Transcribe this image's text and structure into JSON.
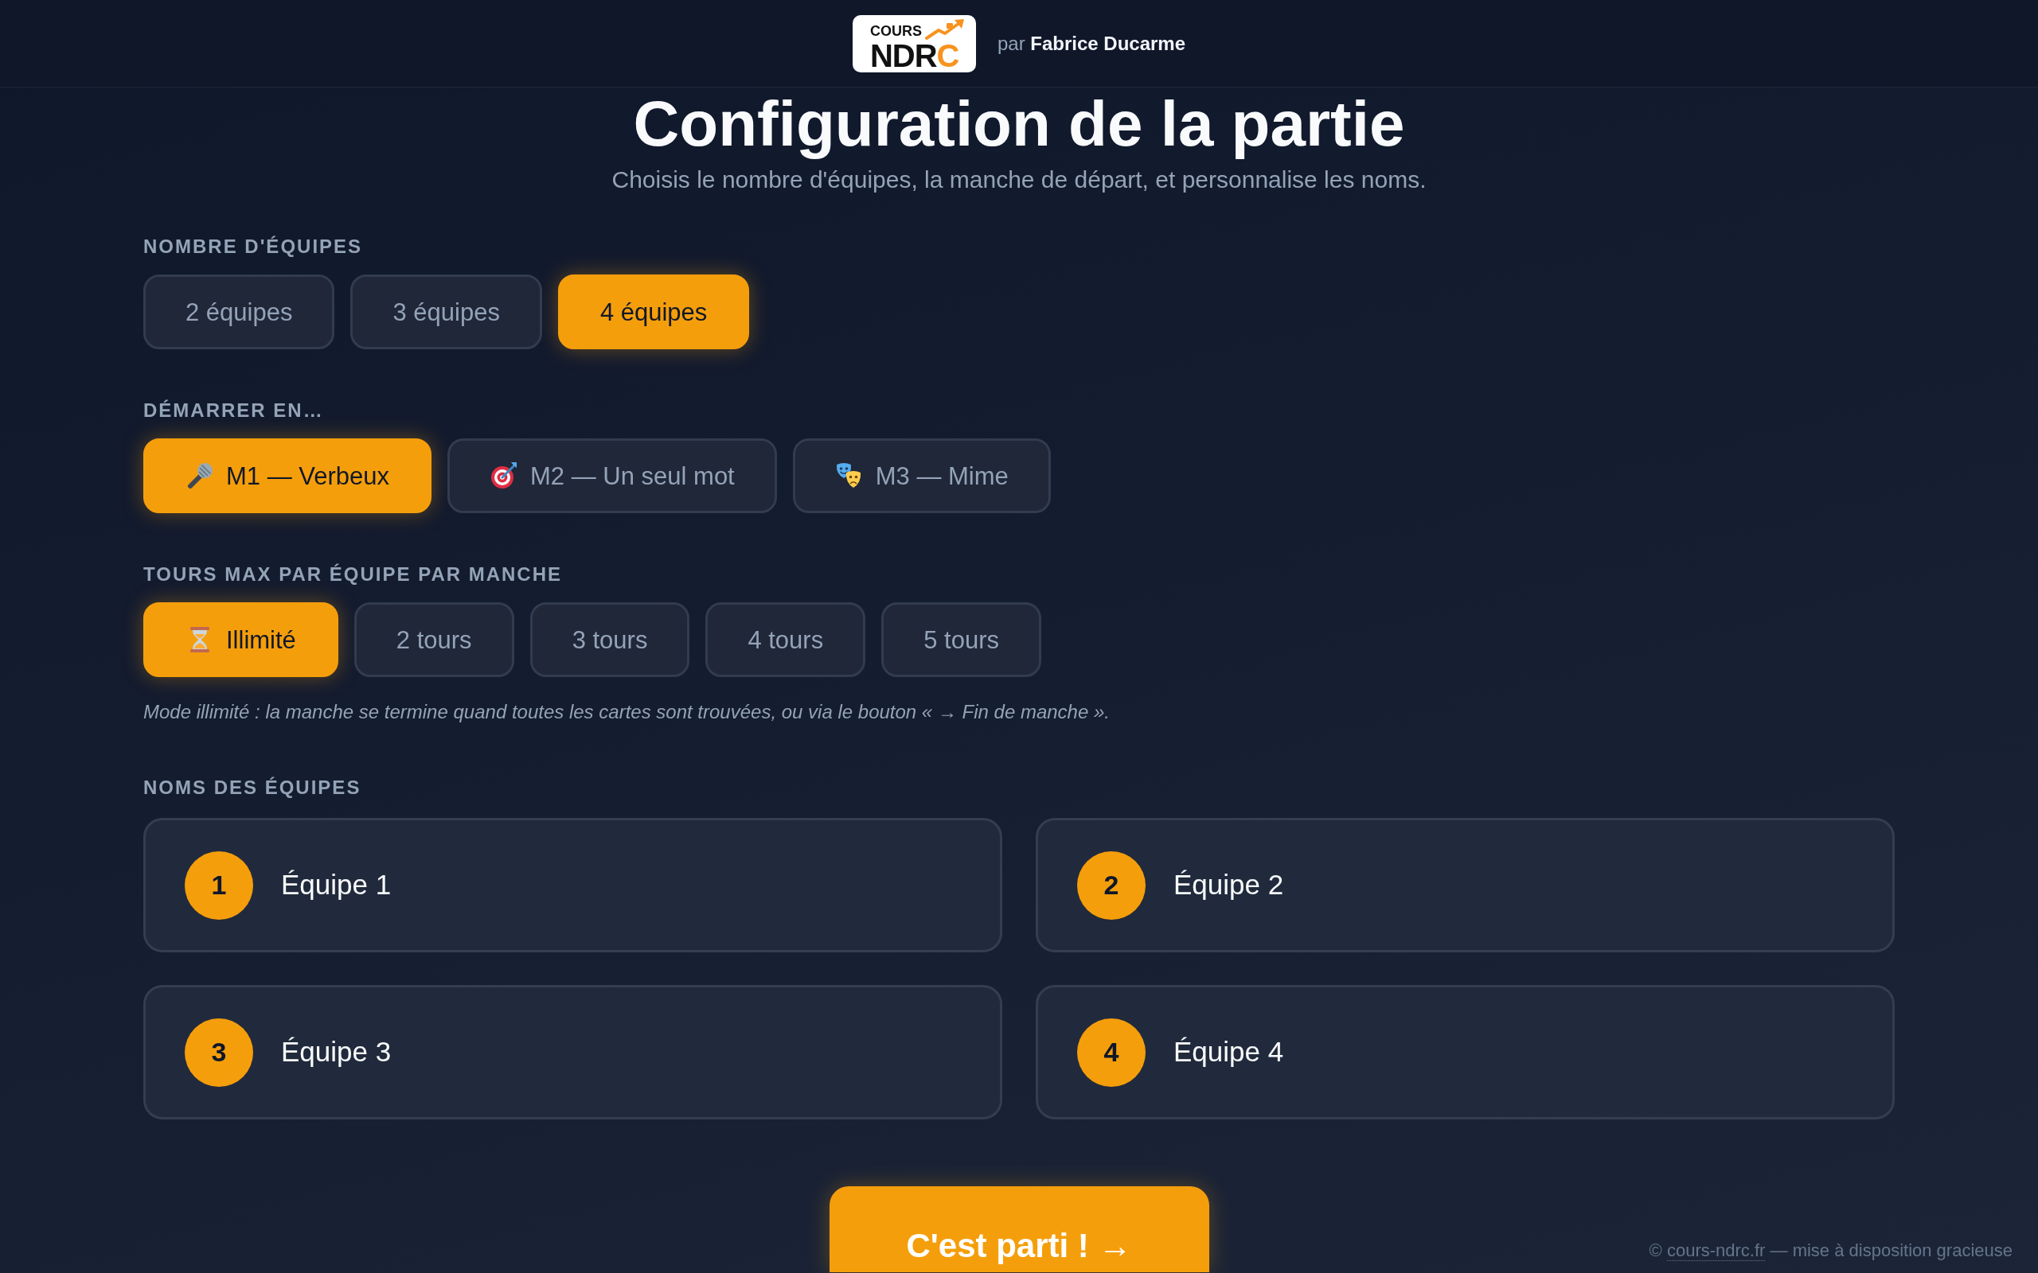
{
  "header": {
    "logo": {
      "caption": "COURS",
      "wordmark": "NDRC"
    },
    "byline": "par **Fabrice Ducarme**"
  },
  "page": {
    "title": "Configuration de la partie",
    "subtitle": "Choisis le nombre d'équipes, la manche de départ, et personnalise les noms."
  },
  "sections": [
    {
      "kind": "team_count",
      "label": "NOMBRE D'ÉQUIPES",
      "options": [
        {
          "label": "2 équipes",
          "selected": false
        },
        {
          "label": "3 équipes",
          "selected": false
        },
        {
          "label": "4 équipes",
          "selected": true
        }
      ]
    },
    {
      "kind": "start_round",
      "label": "DÉMARRER EN…",
      "options": [
        {
          "label": "M1 — Verbeux",
          "selected": true
        },
        {
          "label": "M2 — Un seul mot",
          "selected": false
        },
        {
          "label": "M3 — Mime",
          "selected": false
        }
      ]
    },
    {
      "kind": "turn_limit",
      "label": "TOURS MAX PAR ÉQUIPE PAR MANCHE",
      "options": [
        {
          "label": "Illimité",
          "selected": true
        },
        {
          "label": "2 tours",
          "selected": false
        },
        {
          "label": "3 tours",
          "selected": false
        },
        {
          "label": "4 tours",
          "selected": false
        },
        {
          "label": "5 tours",
          "selected": false
        }
      ],
      "note": "Mode illimité : la manche se termine quand toutes les cartes sont trouvées, ou via le bouton « → Fin de manche »."
    },
    {
      "kind": "team_names",
      "label": "NOMS DES ÉQUIPES",
      "teams": [
        {
          "number": "1",
          "name": "Équipe 1"
        },
        {
          "number": "2",
          "name": "Équipe 2"
        },
        {
          "number": "3",
          "name": "Équipe 3"
        },
        {
          "number": "4",
          "name": "Équipe 4"
        }
      ]
    }
  ],
  "start_button": {
    "label": "C'est parti ! →"
  },
  "footer": {
    "prefix": "©",
    "link": "cours-ndrc.fr",
    "suffix": "— mise à disposition gracieuse"
  }
}
